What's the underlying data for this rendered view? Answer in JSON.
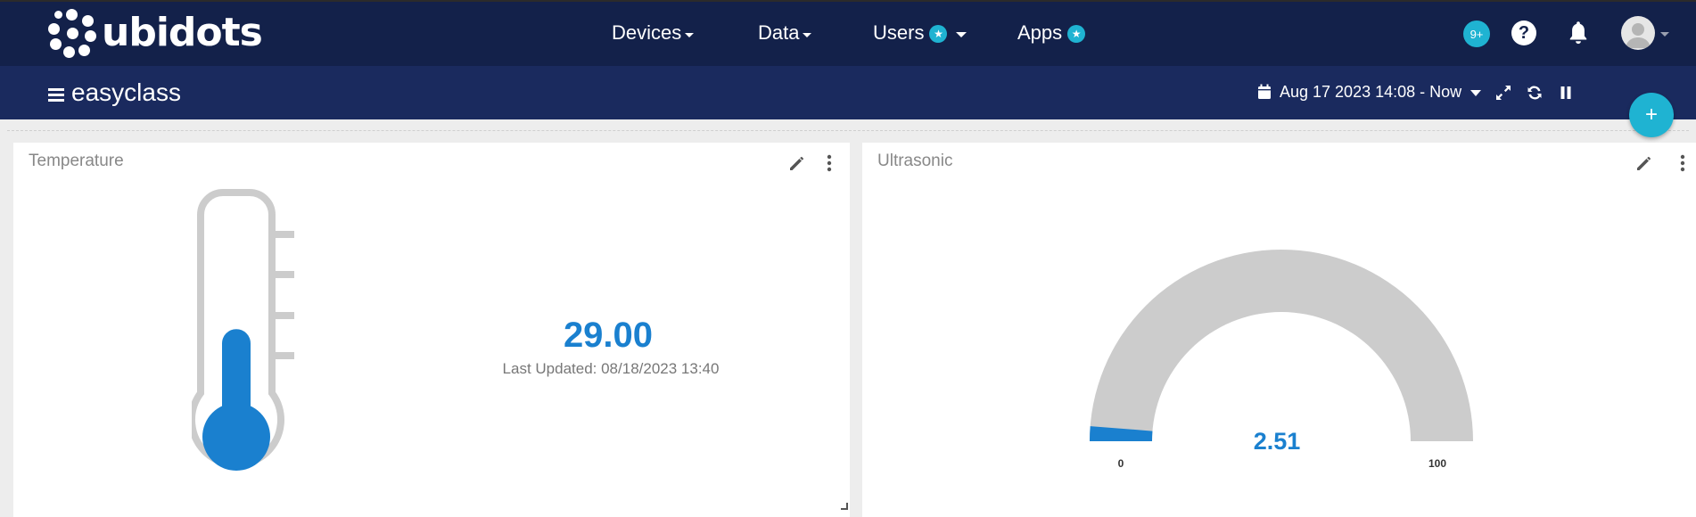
{
  "brand": {
    "name": "ubidots"
  },
  "nav": {
    "devices": "Devices",
    "data": "Data",
    "users": "Users",
    "apps": "Apps"
  },
  "header": {
    "notifications_badge": "9+",
    "help_symbol": "?"
  },
  "dashboard": {
    "title": "easyclass",
    "date_range": "Aug 17 2023 14:08 - Now",
    "fab_symbol": "+"
  },
  "widgets": {
    "temperature": {
      "title": "Temperature",
      "value": "29.00",
      "last_updated": "Last Updated: 08/18/2023 13:40",
      "level_fraction": 0.42
    },
    "ultrasonic": {
      "title": "Ultrasonic",
      "value": "2.51",
      "min_label": "0",
      "max_label": "100",
      "min": 0,
      "max": 100,
      "gauge_value": 2.51
    }
  },
  "colors": {
    "topbar": "#13214a",
    "subbar": "#1a2a5e",
    "accent": "#1fb3d2",
    "value_blue": "#1a80cf",
    "gauge_track": "#cccccc"
  }
}
